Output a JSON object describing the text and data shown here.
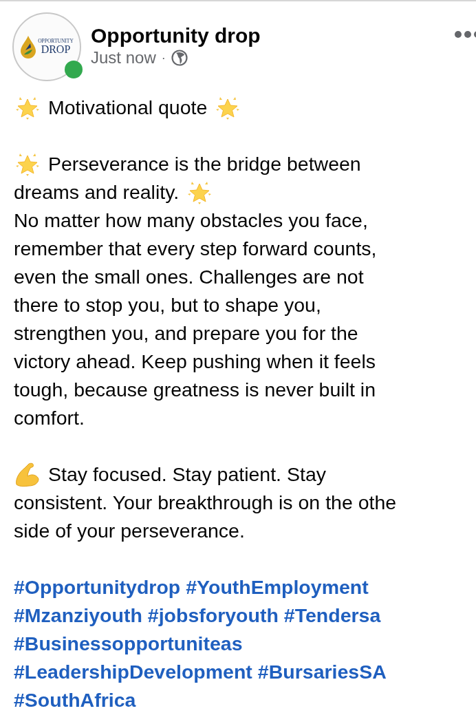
{
  "post": {
    "author": "Opportunity drop",
    "avatar": {
      "logo_top": "OPPORTUNITY",
      "logo_bottom": "DROP",
      "online": true
    },
    "time": "Just now",
    "separator": "·",
    "paragraphs": [
      {
        "kind": "icon_lines",
        "lines": [
          {
            "kind": "star_both",
            "text": "Motivational quote"
          }
        ]
      },
      {
        "kind": "icon_lines",
        "lines": [
          {
            "kind": "star_lead",
            "text": "Perseverance is the bridge between"
          },
          {
            "kind": "star_trail",
            "text": "dreams and reality."
          }
        ]
      },
      {
        "kind": "continuation",
        "lines": [
          "No matter how many obstacles you face,",
          "remember that every step forward counts,",
          "even the small ones. Challenges are not",
          "there to stop you, but to shape you,",
          "strengthen you, and prepare you for the",
          "victory ahead. Keep pushing when it feels",
          "tough, because greatness is never built in",
          "comfort."
        ]
      },
      {
        "kind": "icon_lines",
        "lines": [
          {
            "kind": "arm_lead",
            "text": "Stay focused. Stay patient. Stay"
          },
          {
            "kind": "plain",
            "text": "consistent. Your breakthrough is on the othe"
          },
          {
            "kind": "plain",
            "text": "side of your perseverance."
          }
        ]
      }
    ],
    "hashtags": [
      [
        "#Opportunitydrop",
        "#YouthEmployment"
      ],
      [
        "#Mzanziyouth",
        "#jobsforyouth",
        "#Tendersa"
      ],
      [
        "#Businessopportuniteas"
      ],
      [
        "#LeadershipDevelopment",
        "#BursariesSA"
      ],
      [
        "#SouthAfrica"
      ]
    ]
  }
}
